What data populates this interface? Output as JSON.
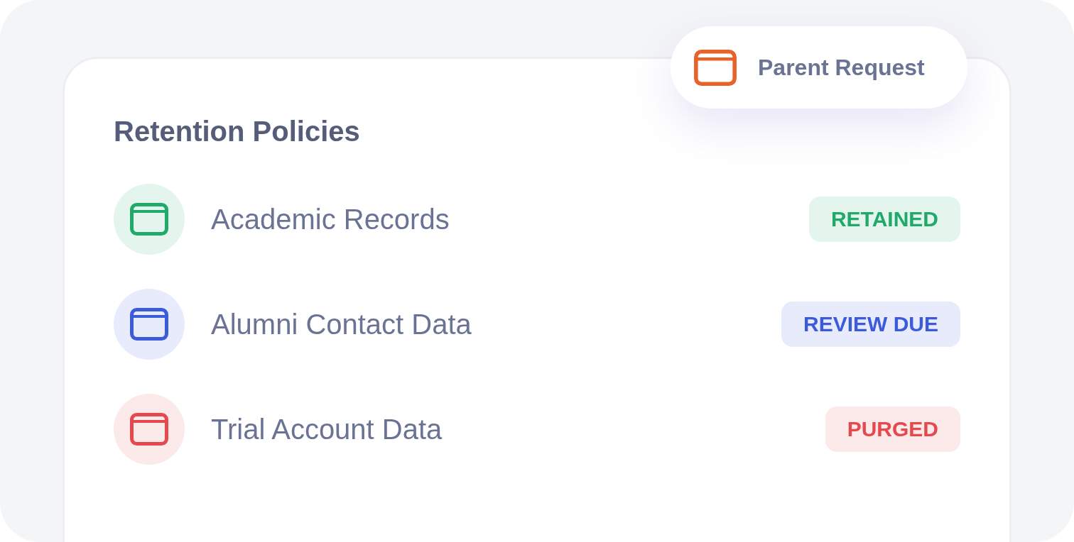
{
  "floating_tag": {
    "label": "Parent Request"
  },
  "card": {
    "title": "Retention Policies"
  },
  "policies": [
    {
      "name": "Academic Records",
      "status": "RETAINED",
      "color": "#1faa6a"
    },
    {
      "name": "Alumni Contact Data",
      "status": "REVIEW DUE",
      "color": "#3b5bdb"
    },
    {
      "name": "Trial Account Data",
      "status": "PURGED",
      "color": "#e5484d"
    }
  ]
}
